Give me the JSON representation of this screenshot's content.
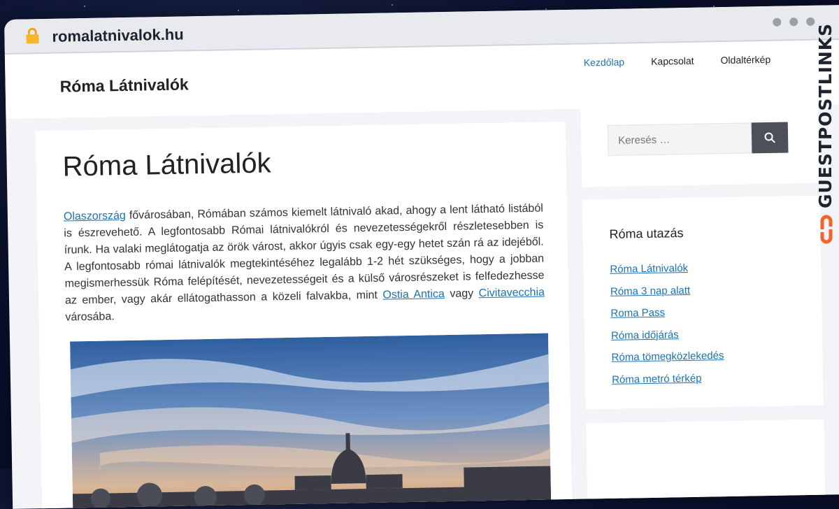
{
  "browser": {
    "url": "romalatnivalok.hu"
  },
  "header": {
    "site_title": "Róma Látnivalók",
    "nav": [
      "Kezdőlap",
      "Kapcsolat",
      "Oldaltérkép"
    ]
  },
  "article": {
    "title": "Róma Látnivalók",
    "intro": {
      "link1": "Olaszország",
      "text1": " fővárosában, Rómában számos kiemelt látnivaló akad, ahogy a lent látható listából is észrevehető. A legfontosabb Római látnivalókról és nevezetességekről részletesebben is írunk. Ha valaki meglátogatja az örök várost, akkor úgyis csak egy-egy hetet szán rá az idejéből. A legfontosabb római látnivalók megtekintéséhez legalább 1-2 hét szükséges, hogy a jobban megismerhessük Róma felépítését, nevezetességeit és a külső városrészeket is felfedezhesse az ember, vagy akár ellátogathasson a közeli falvakba, mint ",
      "link2": "Ostia Antica",
      "text2": " vagy ",
      "link3": "Civitavecchia",
      "text3": " városába."
    }
  },
  "sidebar": {
    "search_placeholder": "Keresés …",
    "widget_title": "Róma utazás",
    "links": [
      "Róma Látnivalók",
      "Róma 3 nap alatt",
      "Roma Pass",
      "Róma időjárás",
      "Róma tömegközlekedés",
      "Róma metró térkép"
    ]
  },
  "watermark": {
    "text": "GUESTPOSTLINKS"
  },
  "colors": {
    "link": "#1b73b4",
    "search_button": "#4c5058",
    "brand_orange": "#f2642b"
  },
  "icons": [
    "lock-icon",
    "search-icon",
    "guestpostlinks-logo-icon"
  ]
}
